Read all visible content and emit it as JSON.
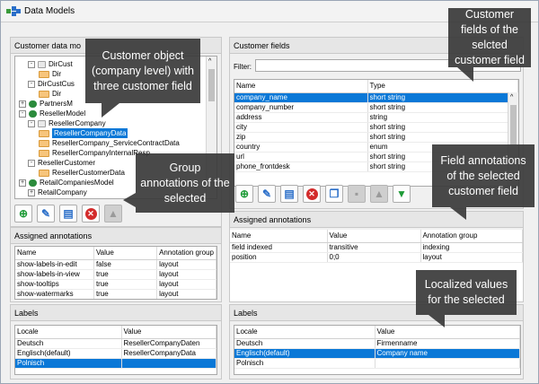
{
  "window": {
    "title": "Data Models"
  },
  "left_tree_panel": {
    "header": "Customer data mo",
    "tree": [
      {
        "label": "DirCust",
        "icon": "component-icon",
        "expander": "-"
      },
      {
        "label": "Dir",
        "icon": "field-icon"
      },
      {
        "label": "DirCustCus",
        "icon": "",
        "expander": "-"
      },
      {
        "label": "Dir",
        "icon": "field-icon"
      },
      {
        "label": "PartnersM",
        "icon": "person-icon",
        "expander": "+"
      },
      {
        "label": "ResellerModel",
        "icon": "person-icon",
        "expander": "-"
      },
      {
        "label": "ResellerCompany",
        "icon": "folder-icon",
        "expander": "-"
      },
      {
        "label": "ResellerCompanyData",
        "icon": "field-icon",
        "selected": true
      },
      {
        "label": "ResellerCompany_ServiceContractData",
        "icon": "field-icon"
      },
      {
        "label": "ResellerCompanyInternalResp",
        "icon": "field-icon"
      },
      {
        "label": "ResellerCustomer",
        "icon": "",
        "expander": "-"
      },
      {
        "label": "ResellerCustomerData",
        "icon": "field-icon"
      },
      {
        "label": "RetailCompaniesModel",
        "icon": "person-icon",
        "expander": "+"
      },
      {
        "label": "RetailCompany",
        "icon": "",
        "expander": "+"
      }
    ]
  },
  "left_annotations": {
    "header": "Assigned annotations",
    "columns": [
      "Name",
      "Value",
      "Annotation group"
    ],
    "rows": [
      [
        "show-labels-in-edit",
        "false",
        "layout"
      ],
      [
        "show-labels-in-view",
        "true",
        "layout"
      ],
      [
        "show-tooltips",
        "true",
        "layout"
      ],
      [
        "show-watermarks",
        "true",
        "layout"
      ]
    ]
  },
  "left_labels": {
    "header": "Labels",
    "columns": [
      "Locale",
      "Value"
    ],
    "rows": [
      [
        "Deutsch",
        "ResellerCompanyDaten"
      ],
      [
        "Englisch(default)",
        "ResellerCompanyData"
      ],
      [
        "Polnisch",
        ""
      ]
    ],
    "selected_row": 2
  },
  "right_fields": {
    "header": "Customer fields",
    "filter_label": "Filter:",
    "filter_value": "",
    "columns": [
      "Name",
      "Type"
    ],
    "rows": [
      [
        "company_name",
        "short string"
      ],
      [
        "company_number",
        "short string"
      ],
      [
        "address",
        "string"
      ],
      [
        "city",
        "short string"
      ],
      [
        "zip",
        "short string"
      ],
      [
        "country",
        "enum"
      ],
      [
        "url",
        "short string"
      ],
      [
        "phone_frontdesk",
        "short string"
      ]
    ],
    "selected_row": 0
  },
  "right_annotations": {
    "header": "Assigned annotations",
    "columns": [
      "Name",
      "Value",
      "Annotation group"
    ],
    "rows": [
      [
        "field indexed",
        "transitive",
        "indexing"
      ],
      [
        "position",
        "0;0",
        "layout"
      ]
    ]
  },
  "right_labels": {
    "header": "Labels",
    "columns": [
      "Locale",
      "Value"
    ],
    "rows": [
      [
        "Deutsch",
        "Firmenname"
      ],
      [
        "Englisch(default)",
        "Company name"
      ],
      [
        "Polnisch",
        ""
      ]
    ],
    "selected_row": 1
  },
  "callouts": {
    "c1": "Customer object (company level) with three customer field",
    "c2": "Group annotations of the selected",
    "c3": "Customer fields of the selcted customer field",
    "c4": "Field annotations of the selected customer field",
    "c5": "Localized values for the selected"
  },
  "toolbar_icons": [
    "add-icon",
    "edit-icon",
    "edit-annotations-icon",
    "delete-icon",
    "copy-icon",
    "disabled-icon",
    "move-up-icon",
    "move-down-icon"
  ],
  "colors": {
    "selection": "#0a78d7",
    "callout": "#3a3a3a"
  }
}
